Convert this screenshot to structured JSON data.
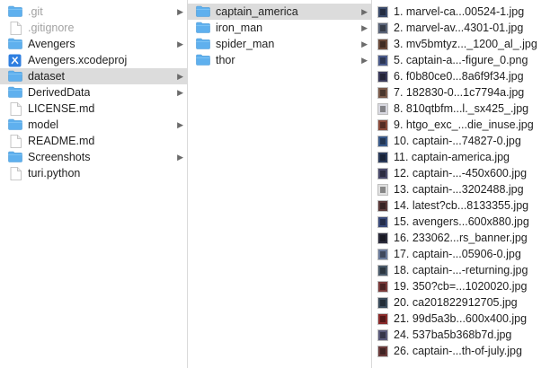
{
  "column1": {
    "items": [
      {
        "label": ".git",
        "kind": "folder",
        "dim": true,
        "has_children": true,
        "selected": false
      },
      {
        "label": ".gitignore",
        "kind": "file",
        "dim": true,
        "has_children": false,
        "selected": false
      },
      {
        "label": "Avengers",
        "kind": "folder",
        "dim": false,
        "has_children": true,
        "selected": false
      },
      {
        "label": "Avengers.xcodeproj",
        "kind": "xcode",
        "dim": false,
        "has_children": false,
        "selected": false
      },
      {
        "label": "dataset",
        "kind": "folder",
        "dim": false,
        "has_children": true,
        "selected": true
      },
      {
        "label": "DerivedData",
        "kind": "folder",
        "dim": false,
        "has_children": true,
        "selected": false
      },
      {
        "label": "LICENSE.md",
        "kind": "file",
        "dim": false,
        "has_children": false,
        "selected": false
      },
      {
        "label": "model",
        "kind": "folder",
        "dim": false,
        "has_children": true,
        "selected": false
      },
      {
        "label": "README.md",
        "kind": "file",
        "dim": false,
        "has_children": false,
        "selected": false
      },
      {
        "label": "Screenshots",
        "kind": "folder",
        "dim": false,
        "has_children": true,
        "selected": false
      },
      {
        "label": "turi.python",
        "kind": "file",
        "dim": false,
        "has_children": false,
        "selected": false
      }
    ]
  },
  "column2": {
    "items": [
      {
        "label": "captain_america",
        "kind": "folder",
        "has_children": true,
        "selected": true
      },
      {
        "label": "iron_man",
        "kind": "folder",
        "has_children": true,
        "selected": false
      },
      {
        "label": "spider_man",
        "kind": "folder",
        "has_children": true,
        "selected": false
      },
      {
        "label": "thor",
        "kind": "folder",
        "has_children": true,
        "selected": false
      }
    ]
  },
  "column3": {
    "items": [
      {
        "label": "1. marvel-ca...00524-1.jpg",
        "thumb": "#3a4a6a"
      },
      {
        "label": "2. marvel-av...4301-01.jpg",
        "thumb": "#5a6478"
      },
      {
        "label": "3. mv5bmtyz..._1200_al_.jpg",
        "thumb": "#6a4a3a"
      },
      {
        "label": "5. captain-a...-figure_0.png",
        "thumb": "#4a5a8a"
      },
      {
        "label": "6. f0b80ce0...8a6f9f34.jpg",
        "thumb": "#3a3a5a"
      },
      {
        "label": "7. 182830-0...1c7794a.jpg",
        "thumb": "#7a5a4a"
      },
      {
        "label": "8. 810qtbfm...l._sx425_.jpg",
        "thumb": "#d8d8e0"
      },
      {
        "label": "9. htgo_exc_...die_inuse.jpg",
        "thumb": "#8a4a3a"
      },
      {
        "label": "10. captain-...74827-0.jpg",
        "thumb": "#3a5a8a"
      },
      {
        "label": "11. captain-america.jpg",
        "thumb": "#2a3a5a"
      },
      {
        "label": "12. captain-...-450x600.jpg",
        "thumb": "#4a4a6a"
      },
      {
        "label": "13. captain-...3202488.jpg",
        "thumb": "#e0e0e0"
      },
      {
        "label": "14. latest?cb...8133355.jpg",
        "thumb": "#5a3a3a"
      },
      {
        "label": "15. avengers...600x880.jpg",
        "thumb": "#3a4a7a"
      },
      {
        "label": "16. 233062...rs_banner.jpg",
        "thumb": "#2a2a3a"
      },
      {
        "label": "17. captain-...05906-0.jpg",
        "thumb": "#6a7a9a"
      },
      {
        "label": "18. captain-...-returning.jpg",
        "thumb": "#4a5a6a"
      },
      {
        "label": "19. 350?cb=...1020020.jpg",
        "thumb": "#7a3a3a"
      },
      {
        "label": "20. ca201822912705.jpg",
        "thumb": "#3a4a5a"
      },
      {
        "label": "21. 99d5a3b...600x400.jpg",
        "thumb": "#8a2a2a"
      },
      {
        "label": "24. 537ba5b368b7d.jpg",
        "thumb": "#5a5a7a"
      },
      {
        "label": "26. captain-...th-of-july.jpg",
        "thumb": "#6a3a3a"
      }
    ]
  }
}
